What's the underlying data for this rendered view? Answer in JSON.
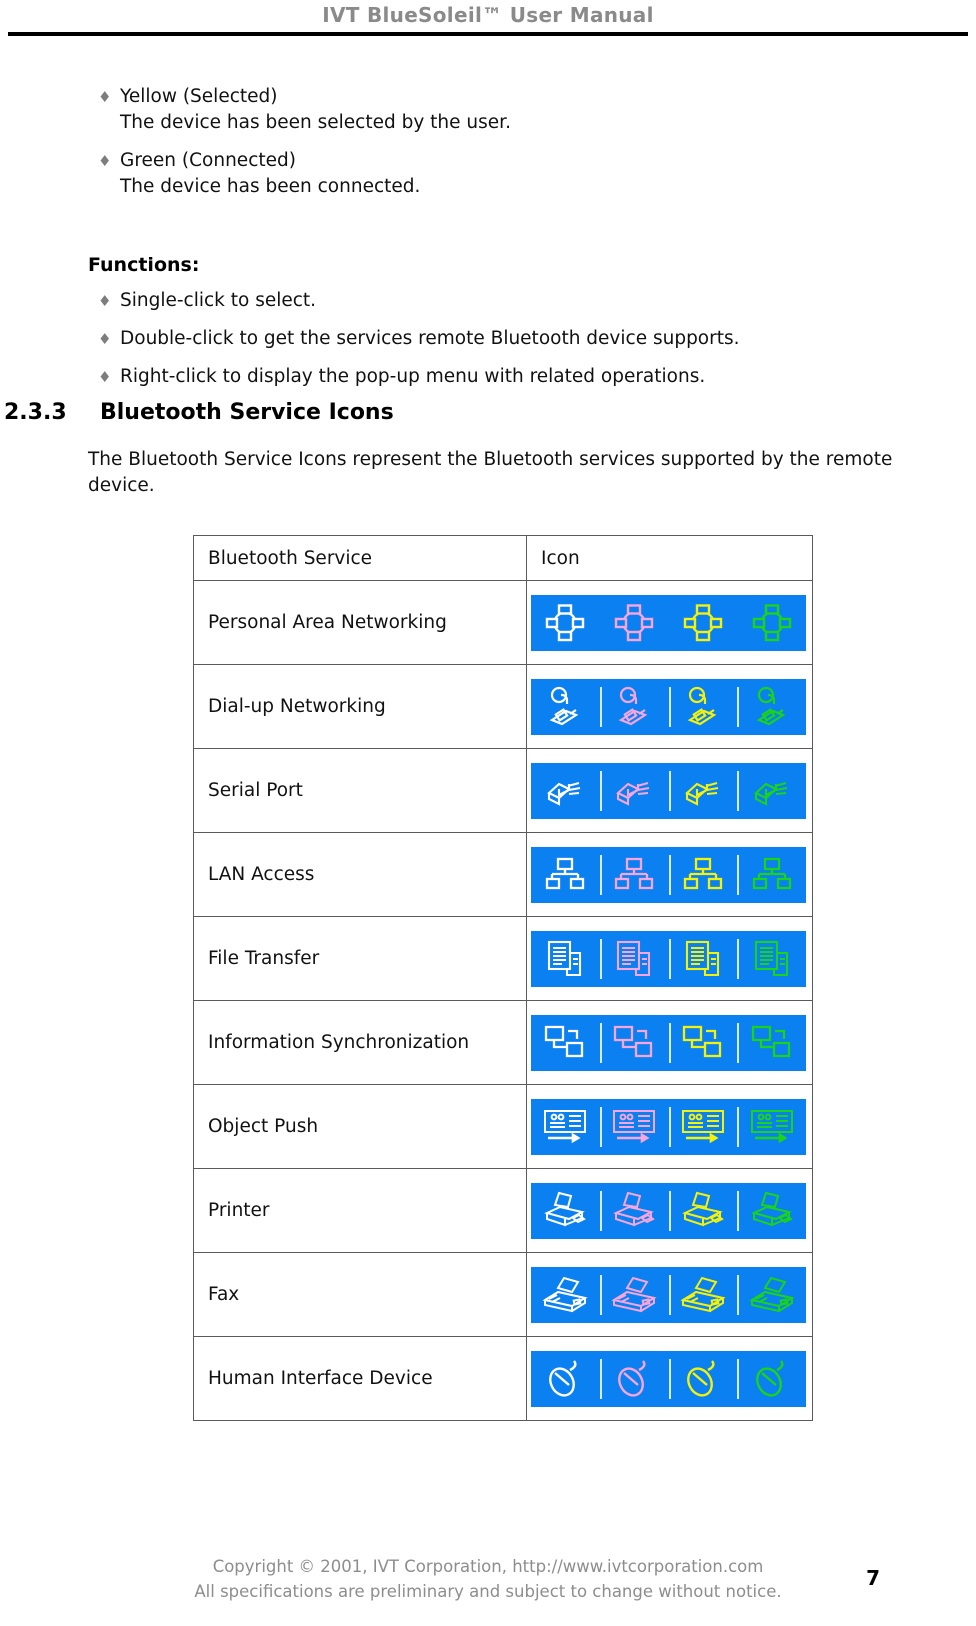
{
  "header": {
    "title": "IVT BlueSoleil™ User Manual"
  },
  "status_bullets": [
    {
      "marker": "♦",
      "line1": "Yellow (Selected)",
      "line2": "The device has been selected by the user."
    },
    {
      "marker": "♦",
      "line1": "Green (Connected)",
      "line2": "The device has been connected."
    }
  ],
  "functions": {
    "label": "Functions:",
    "items": [
      {
        "marker": "♦",
        "text": "Single-click to select."
      },
      {
        "marker": "♦",
        "text": "Double-click to get the services remote Bluetooth device supports."
      },
      {
        "marker": "♦",
        "text": "Right-click to display the pop-up menu with related operations."
      }
    ]
  },
  "section": {
    "number": "2.3.3",
    "title": "Bluetooth Service Icons",
    "paragraph": "The Bluetooth Service Icons represent the Bluetooth services supported by the remote device."
  },
  "table": {
    "columns": [
      "Bluetooth Service",
      "Icon"
    ],
    "icon_background": "#0b80f0",
    "icon_variants": [
      "#ffffff",
      "#f9a5dd",
      "#f2f20a",
      "#19d419"
    ],
    "rows": [
      {
        "service": "Personal Area Networking",
        "icon": "pan-icon"
      },
      {
        "service": "Dial-up Networking",
        "icon": "dialup-icon"
      },
      {
        "service": "Serial Port",
        "icon": "serial-port-icon"
      },
      {
        "service": "LAN Access",
        "icon": "lan-access-icon"
      },
      {
        "service": "File Transfer",
        "icon": "file-transfer-icon"
      },
      {
        "service": "Information Synchronization",
        "icon": "sync-icon"
      },
      {
        "service": "Object Push",
        "icon": "object-push-icon"
      },
      {
        "service": "Printer",
        "icon": "printer-icon"
      },
      {
        "service": "Fax",
        "icon": "fax-icon"
      },
      {
        "service": "Human Interface Device",
        "icon": "mouse-icon"
      }
    ]
  },
  "footer": {
    "line1": "Copyright © 2001, IVT Corporation, http://www.ivtcorporation.com",
    "line2": "All specifications are preliminary and subject to change without notice.",
    "page_number": "7"
  }
}
